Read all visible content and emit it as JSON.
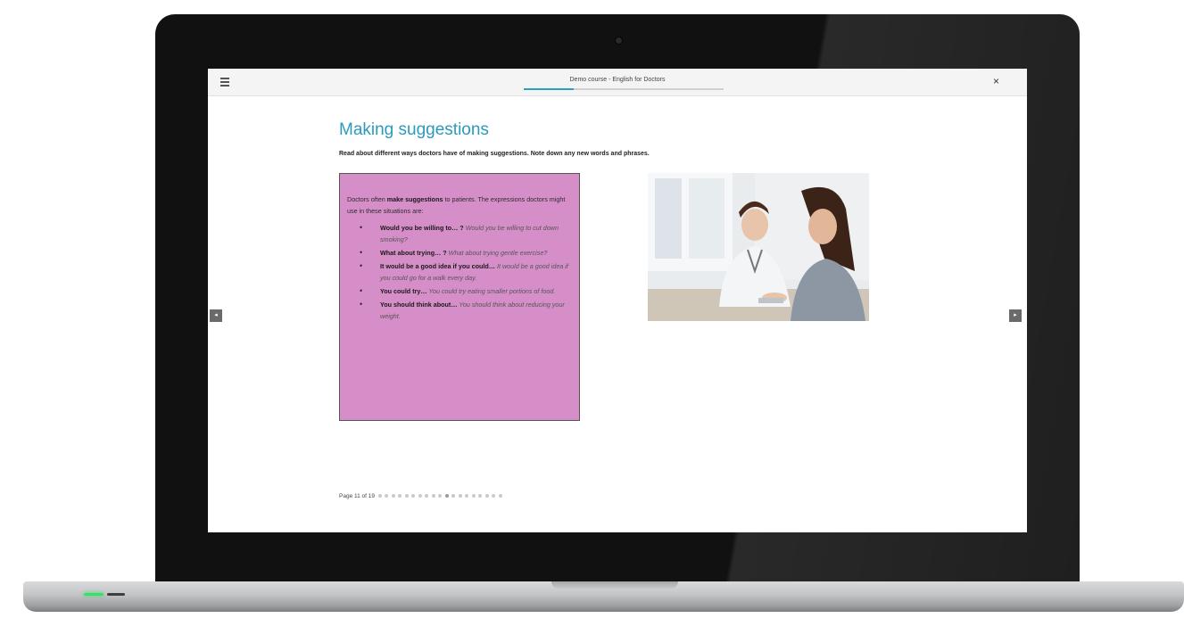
{
  "course": {
    "title": "Demo course - English for Doctors",
    "progress_fraction": 0.25
  },
  "topbar": {
    "menu_icon": "hamburger-menu-icon",
    "close_icon": "close-icon",
    "close_label": "×"
  },
  "lesson": {
    "title": "Making suggestions",
    "instruction": "Read about different ways doctors have of making suggestions. Note down any new words and phrases.",
    "box": {
      "intro_prefix": "Doctors often ",
      "intro_bold": "make suggestions",
      "intro_suffix": " to patients. The expressions doctors might use in these situations are:",
      "items": [
        {
          "phrase": "Would you be willing to… ?",
          "example": "Would you be willing to cut down smoking?"
        },
        {
          "phrase": "What about trying… ?",
          "example": "What about trying gentle exercise?"
        },
        {
          "phrase": "It would be a good idea if you could…",
          "example": "It would be a good idea if you could go for a walk every day."
        },
        {
          "phrase": "You could try…",
          "example": "You could try eating smaller portions of food."
        },
        {
          "phrase": "You should think about…",
          "example": "You should think about reducing your weight."
        }
      ],
      "background_color": "#d68ec9"
    },
    "image": {
      "description_icon": "doctor-patient-photo"
    }
  },
  "navigation": {
    "prev_label": "◂",
    "next_label": "▸"
  },
  "pager": {
    "label": "Page 11 of 19",
    "current_page": 11,
    "total_pages": 19
  },
  "colors": {
    "accent": "#2b9bbd",
    "progress": "#29a0c8"
  }
}
